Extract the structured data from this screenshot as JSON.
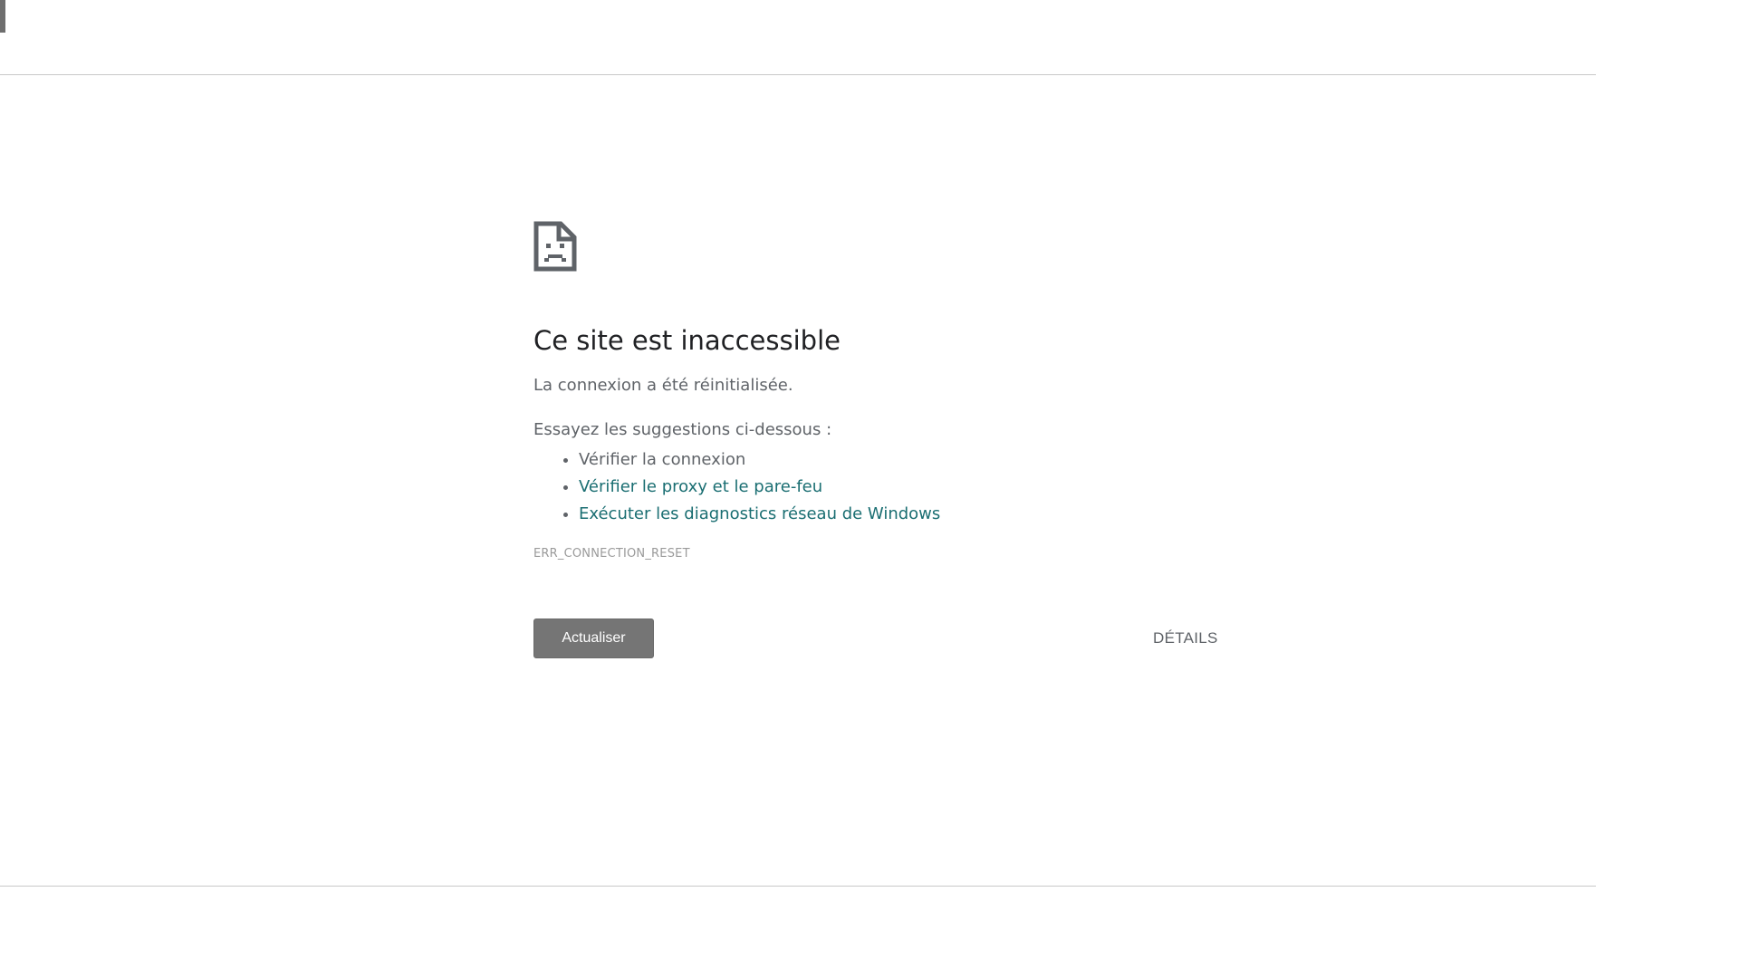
{
  "error_page": {
    "title": "Ce site est inaccessible",
    "message": "La connexion a été réinitialisée.",
    "suggestions_heading": "Essayez les suggestions ci-dessous :",
    "suggestions": [
      {
        "label": "Vérifier la connexion",
        "is_link": false
      },
      {
        "label": "Vérifier le proxy et le pare-feu",
        "is_link": true
      },
      {
        "label": "Exécuter les diagnostics réseau de Windows",
        "is_link": true
      }
    ],
    "error_code": "ERR_CONNECTION_RESET",
    "reload_label": "Actualiser",
    "details_label": "DÉTAILS",
    "icon": "sad-page-icon"
  },
  "colors": {
    "text_primary": "#202124",
    "text_secondary": "#5f6368",
    "link": "#1a6e72",
    "button_bg": "#757575"
  }
}
